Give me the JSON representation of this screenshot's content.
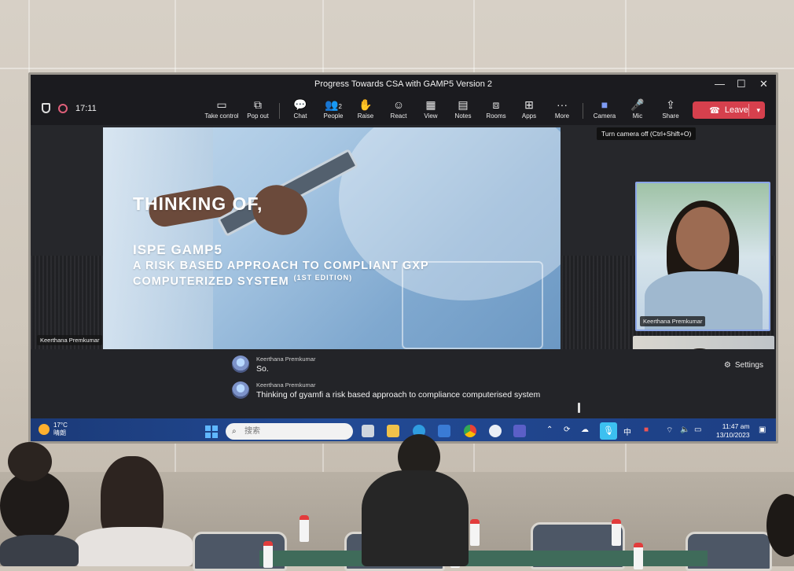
{
  "window": {
    "title": "Progress Towards CSA with GAMP5 Version 2",
    "controls": [
      "—",
      "☐",
      "✕"
    ]
  },
  "toolbar": {
    "time": "17:11",
    "buttons": [
      {
        "label": "Take control",
        "icon": "take-control-icon",
        "glyph": "▭"
      },
      {
        "label": "Pop out",
        "icon": "pop-out-icon",
        "glyph": "⧉"
      },
      {
        "label": "Chat",
        "icon": "chat-icon",
        "glyph": "💬"
      },
      {
        "label": "People",
        "icon": "people-icon",
        "glyph": "👥",
        "badge": "2"
      },
      {
        "label": "Raise",
        "icon": "raise-hand-icon",
        "glyph": "✋"
      },
      {
        "label": "React",
        "icon": "react-icon",
        "glyph": "☺"
      },
      {
        "label": "View",
        "icon": "view-icon",
        "glyph": "▦"
      },
      {
        "label": "Notes",
        "icon": "notes-icon",
        "glyph": "▤"
      },
      {
        "label": "Rooms",
        "icon": "rooms-icon",
        "glyph": "⧈"
      },
      {
        "label": "Apps",
        "icon": "apps-icon",
        "glyph": "⊞"
      },
      {
        "label": "More",
        "icon": "more-icon",
        "glyph": "···"
      },
      {
        "label": "Camera",
        "icon": "camera-icon",
        "glyph": "■"
      },
      {
        "label": "Mic",
        "icon": "mic-icon",
        "glyph": "🎤"
      },
      {
        "label": "Share",
        "icon": "share-icon",
        "glyph": "⇪"
      }
    ],
    "leave_label": "Leave",
    "leave_glyph": "☎",
    "tooltip": "Turn camera off (Ctrl+Shift+O)"
  },
  "slide": {
    "heading": "THINKING OF,",
    "line1": "ISPE GAMP5",
    "line2": "A RISK BASED APPROACH TO COMPLIANT  GXP",
    "line3": "COMPUTERIZED SYSTEM",
    "edition": "(1ST EDITION)"
  },
  "participants": {
    "presenter_name": "Keerthana Premkumar",
    "tile1_name": "Keerthana Premkumar"
  },
  "captions": [
    {
      "speaker": "Keerthana Premkumar",
      "text": "So."
    },
    {
      "speaker": "Keerthana Premkumar",
      "text": "Thinking of gyamfi a risk based approach to compliance computerised system"
    }
  ],
  "settings_label": "Settings",
  "taskbar": {
    "weather_temp": "17°C",
    "weather_desc": "晴朗",
    "search_placeholder": "搜索",
    "lang": "中",
    "time": "11:47 am",
    "date": "13/10/2023"
  },
  "colors": {
    "leave": "#d6404d",
    "taskbar": "#224a94",
    "accent": "#7f9cf5"
  }
}
